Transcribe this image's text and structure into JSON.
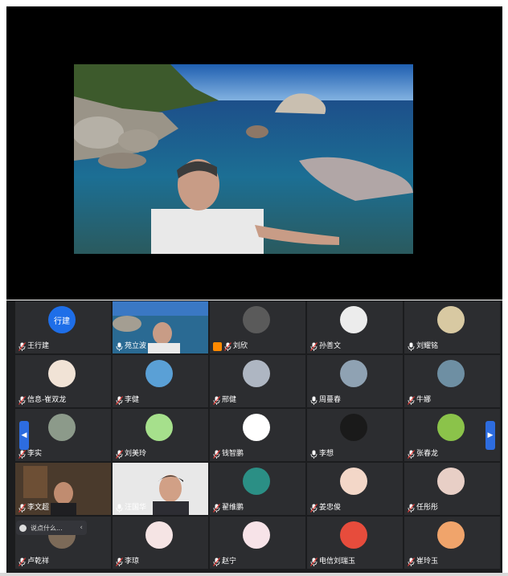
{
  "main_video": {
    "speaker": "苑立波"
  },
  "participants": [
    {
      "name": "王行建",
      "avatar_text": "行建",
      "avatar_type": "text",
      "avatar_color": "#1e6ee8",
      "muted": true
    },
    {
      "name": "苑立波",
      "avatar_type": "video",
      "muted": false,
      "active_speaker": true
    },
    {
      "name": "刘欣",
      "avatar_type": "photo",
      "avatar_color": "#5a5a5a",
      "muted": true,
      "host_badge": true
    },
    {
      "name": "孙善文",
      "avatar_type": "photo",
      "avatar_color": "#ececec",
      "muted": true
    },
    {
      "name": "刘耀铭",
      "avatar_type": "photo",
      "avatar_color": "#d8c9a2",
      "muted": false
    },
    {
      "name": "信息-崔双龙",
      "avatar_type": "photo",
      "avatar_color": "#f1e3d6",
      "muted": true
    },
    {
      "name": "李健",
      "avatar_type": "photo",
      "avatar_color": "#5aa0d6",
      "muted": true
    },
    {
      "name": "邢健",
      "avatar_type": "photo",
      "avatar_color": "#aeb6c2",
      "muted": true
    },
    {
      "name": "周蔓春",
      "avatar_type": "photo",
      "avatar_color": "#8fa2b3",
      "muted": false
    },
    {
      "name": "牛娜",
      "avatar_type": "photo",
      "avatar_color": "#6e8fa3",
      "muted": true
    },
    {
      "name": "李实",
      "avatar_type": "photo",
      "avatar_color": "#8c9a8a",
      "muted": true
    },
    {
      "name": "刘美玲",
      "avatar_type": "photo",
      "avatar_color": "#a6e08c",
      "muted": true
    },
    {
      "name": "钱智鹏",
      "avatar_type": "photo",
      "avatar_color": "#ffffff",
      "muted": true
    },
    {
      "name": "李想",
      "avatar_type": "photo",
      "avatar_color": "#1a1a1a",
      "muted": false
    },
    {
      "name": "张春龙",
      "avatar_type": "photo",
      "avatar_color": "#8bc34a",
      "muted": true
    },
    {
      "name": "李文超",
      "avatar_type": "video",
      "muted": true
    },
    {
      "name": "汪国华",
      "avatar_type": "video",
      "muted": false
    },
    {
      "name": "翟维鹏",
      "avatar_type": "photo",
      "avatar_color": "#2b8f85",
      "muted": true
    },
    {
      "name": "姜忠俊",
      "avatar_type": "photo",
      "avatar_color": "#f3d7c8",
      "muted": true
    },
    {
      "name": "任彤彤",
      "avatar_type": "photo",
      "avatar_color": "#e8cfc6",
      "muted": true
    },
    {
      "name": "卢乾祥",
      "avatar_type": "photo",
      "avatar_color": "#7c6a58",
      "muted": true
    },
    {
      "name": "李琼",
      "avatar_type": "photo",
      "avatar_color": "#f5e4e4",
      "muted": true
    },
    {
      "name": "赵宁",
      "avatar_type": "photo",
      "avatar_color": "#f7e3e8",
      "muted": true
    },
    {
      "name": "电信刘瑞玉",
      "avatar_type": "photo",
      "avatar_color": "#e74c3c",
      "muted": true
    },
    {
      "name": "崔玲玉",
      "avatar_type": "photo",
      "avatar_color": "#f0a46b",
      "muted": true
    }
  ],
  "chat": {
    "placeholder": "说点什么..."
  },
  "navigation": {
    "prev_icon": "chevron-left-icon",
    "next_icon": "chevron-right-icon"
  }
}
